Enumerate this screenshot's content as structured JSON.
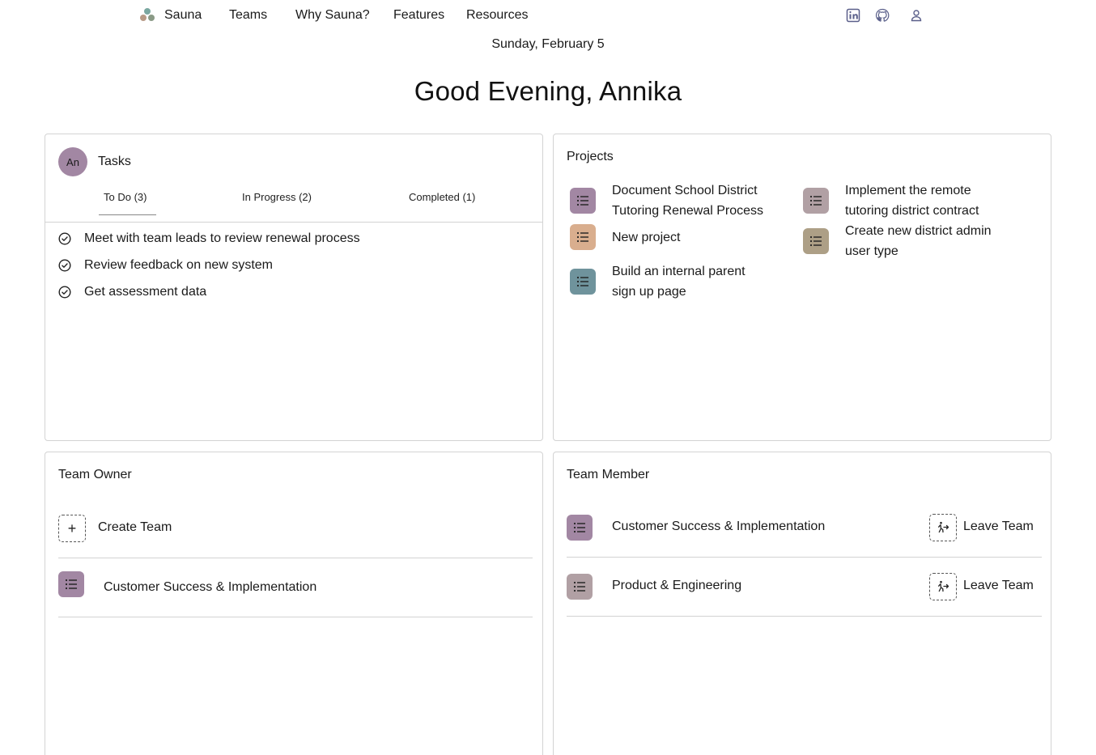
{
  "nav": {
    "brand": "Sauna",
    "links": [
      "Teams",
      "Why Sauna?",
      "Features",
      "Resources"
    ],
    "icons": [
      "linkedin-icon",
      "github-icon",
      "user-icon"
    ]
  },
  "header": {
    "date": "Sunday, February 5",
    "greeting": "Good Evening, Annika"
  },
  "tasks": {
    "avatar": "An",
    "title": "Tasks",
    "tabs": [
      "To Do (3)",
      "In Progress (2)",
      "Completed (1)"
    ],
    "active_tab": "To Do (3)",
    "items": [
      "Meet with team leads to review renewal process",
      "Review feedback on new system",
      "Get assessment data"
    ]
  },
  "projects": {
    "title": "Projects",
    "items": [
      {
        "line1": "Document School District",
        "line2": "Tutoring Renewal Process",
        "color": "#a287a3"
      },
      {
        "line1": "Implement the remote",
        "line2": "tutoring district contract",
        "color": "#b1a0a4"
      },
      {
        "line1": "New project",
        "line2": "",
        "color": "#d9ae8e"
      },
      {
        "line1": "Create new district admin",
        "line2": "user type",
        "color": "#ad9f86"
      },
      {
        "line1": "Build an internal parent",
        "line2": "sign up page",
        "color": "#6f939c"
      }
    ]
  },
  "team_owner": {
    "title": "Team Owner",
    "create_label": "Create Team",
    "teams": [
      {
        "name": "Customer Success & Implementation",
        "color": "#a287a3"
      }
    ]
  },
  "team_member": {
    "title": "Team Member",
    "leave_label": "Leave Team",
    "teams": [
      {
        "name": "Customer Success & Implementation",
        "color": "#a287a3"
      },
      {
        "name": "Product & Engineering",
        "color": "#b1a0a4"
      }
    ]
  }
}
